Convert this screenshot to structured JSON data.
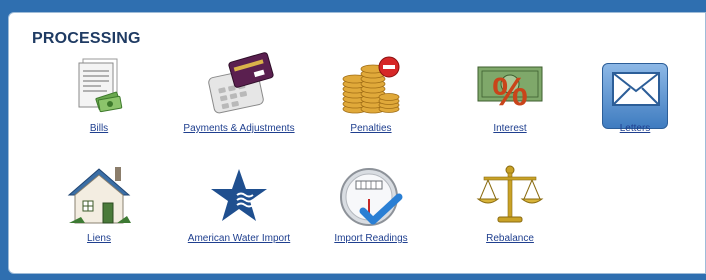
{
  "section": {
    "title": "PROCESSING"
  },
  "tiles": [
    {
      "label": "Bills",
      "icon": "bills-document-icon"
    },
    {
      "label": "Payments & Adjustments",
      "icon": "credit-card-terminal-icon"
    },
    {
      "label": "Penalties",
      "icon": "coins-minus-icon"
    },
    {
      "label": "Interest",
      "icon": "money-percent-icon"
    },
    {
      "label": "Letters",
      "icon": "envelope-icon"
    },
    {
      "label": "Liens",
      "icon": "house-icon"
    },
    {
      "label": "American Water Import",
      "icon": "water-star-icon"
    },
    {
      "label": "Import Readings",
      "icon": "meter-gauge-icon"
    },
    {
      "label": "Rebalance",
      "icon": "scales-icon"
    }
  ],
  "colors": {
    "frame": "#2f6fb0",
    "title": "#1f3b63",
    "link": "#1f3f8f",
    "selected_tile": "#3f7cc0"
  }
}
